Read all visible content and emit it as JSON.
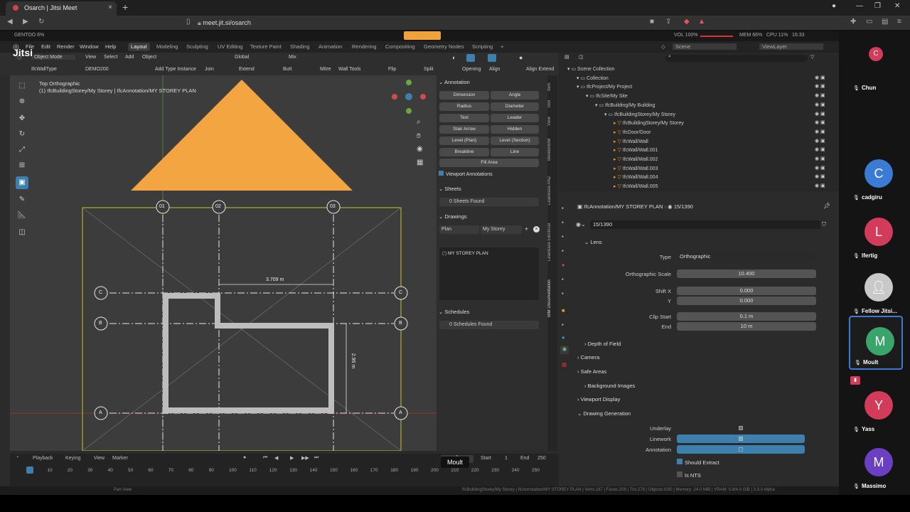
{
  "browser": {
    "tab_title": "Osarch | Jitsi Meet",
    "url": "meet.jit.si/osarch",
    "new_tab_symbol": "+",
    "tab_close": "×"
  },
  "blender_top": {
    "left": "GENTOO 6%",
    "vol": "VOL 100%",
    "mem": "MEM 66%",
    "cpu": "CPU 11%",
    "time": "16:33"
  },
  "menu": {
    "items": [
      "File",
      "Edit",
      "Render",
      "Window",
      "Help"
    ],
    "workspaces": [
      "Layout",
      "Modeling",
      "Sculpting",
      "UV Editing",
      "Texture Paint",
      "Shading",
      "Animation",
      "Rendering",
      "Compositing",
      "Geometry Nodes",
      "Scripting"
    ],
    "active_workspace": "Layout",
    "scene": "Scene",
    "viewlayer": "ViewLayer"
  },
  "header": {
    "mode": "Object Mode",
    "view": "View",
    "select": "Select",
    "add": "Add",
    "object": "Object",
    "transform": "Global",
    "mix": "Mix",
    "wall_type": "IfcWallType",
    "demo": "DEMO200",
    "tools": [
      "Add Type Instance",
      "Join",
      "Extend",
      "Butt",
      "Mitre",
      "Wall Tools",
      "Flip",
      "Split",
      "Opening",
      "Align",
      "Align Extend"
    ]
  },
  "viewport": {
    "title": "Top Orthographic",
    "subtitle": "(1) IfcBuildingStorey/My Storey | IfcAnnotation/MY STOREY PLAN",
    "grid_labels_top": [
      "01",
      "02",
      "03"
    ],
    "grid_labels_side": [
      "C",
      "B",
      "A"
    ],
    "dim_horizontal": "3.709 m",
    "dim_vertical": "2.95 m"
  },
  "npanel": {
    "annotation_title": "Annotation",
    "buttons": [
      [
        "Dimension",
        "Angle"
      ],
      [
        "Radius",
        "Diameter"
      ],
      [
        "Text",
        "Leader"
      ],
      [
        "Stair Arrow",
        "Hidden"
      ],
      [
        "Level (Plan)",
        "Level (Section)"
      ],
      [
        "Breakline",
        "Line"
      ]
    ],
    "fill_area": "Fill Area",
    "viewport_annotations": "Viewport Annotations",
    "sheets_title": "Sheets",
    "sheets_found": "0 Sheets Found",
    "drawings_title": "Drawings",
    "drawing_type": "Plan",
    "drawing_storey": "My Storey",
    "drawing_item": "MY STOREY PLAN",
    "schedules_title": "Schedules",
    "schedules_found": "0 Schedules Found",
    "vtabs": [
      "Item",
      "Tool",
      "View",
      "BlenderBIM",
      "LeanBase ANZ",
      "LeanBase Electrical",
      "BIM Documentation"
    ]
  },
  "timeline": {
    "playback": "Playback",
    "keying": "Keying",
    "view": "View",
    "marker": "Marker",
    "current_frame": "1",
    "start_label": "Start",
    "start_value": "1",
    "end_label": "End",
    "end_value": "250",
    "ticks": [
      "1",
      "10",
      "20",
      "30",
      "40",
      "50",
      "60",
      "70",
      "80",
      "90",
      "100",
      "110",
      "120",
      "130",
      "140",
      "150",
      "160",
      "170",
      "180",
      "190",
      "200",
      "210",
      "220",
      "230",
      "240",
      "250"
    ]
  },
  "status_bar": {
    "left": "Pan View",
    "right": "IfcBuildingStorey/My Storey | IfcAnnotation/MY STOREY PLAN | Verts:187 | Faces:209 | Tris:278 | Objects:0/30 | Memory: 24.0 MiB | VRAM: 0.8/4.0 GiB | 3.3.0 Alpha"
  },
  "outliner": {
    "rows": [
      {
        "label": "Scene Collection",
        "indent": 0
      },
      {
        "label": "Collection",
        "indent": 1
      },
      {
        "label": "IfcProject/My Project",
        "indent": 1
      },
      {
        "label": "IfcSite/My Site",
        "indent": 2
      },
      {
        "label": "IfcBuilding/My Building",
        "indent": 3
      },
      {
        "label": "IfcBuildingStorey/My Storey",
        "indent": 4
      },
      {
        "label": "IfcBuildingStorey/My Storey",
        "indent": 5
      },
      {
        "label": "IfcDoor/Door",
        "indent": 5
      },
      {
        "label": "IfcWall/Wall",
        "indent": 5
      },
      {
        "label": "IfcWall/Wall.001",
        "indent": 5
      },
      {
        "label": "IfcWall/Wall.002",
        "indent": 5
      },
      {
        "label": "IfcWall/Wall.003",
        "indent": 5
      },
      {
        "label": "IfcWall/Wall.004",
        "indent": 5
      },
      {
        "label": "IfcWall/Wall.005",
        "indent": 5
      }
    ]
  },
  "properties": {
    "object_path": "IfcAnnotation/MY STOREY PLAN",
    "data_name_short": "15/1390",
    "data_name": "15/1390",
    "lens_title": "Lens",
    "type_label": "Type",
    "type_value": "Orthographic",
    "ortho_scale_label": "Orthographic Scale",
    "ortho_scale_value": "10.400",
    "shift_x_label": "Shift X",
    "shift_x_value": "0.000",
    "shift_y_label": "Y",
    "shift_y_value": "0.000",
    "clip_start_label": "Clip Start",
    "clip_start_value": "0.1 m",
    "clip_end_label": "End",
    "clip_end_value": "10 m",
    "sections": [
      "Depth of Field",
      "Camera",
      "Safe Areas",
      "Background Images",
      "Viewport Display",
      "Drawing Generation"
    ],
    "underlay_label": "Underlay",
    "linework_label": "Linework",
    "annotation_label": "Annotation",
    "should_extract": "Should Extract",
    "is_nts": "Is NTS"
  },
  "jitsi": {
    "app_name": "Jitsi",
    "participants": [
      {
        "initial": "C",
        "name": "Chun",
        "color": "#d23b5a"
      },
      {
        "initial": "C",
        "name": "cadgiru",
        "color": "#3a7bd5"
      },
      {
        "initial": "L",
        "name": "lfertig",
        "color": "#d23b5a"
      },
      {
        "initial": "",
        "name": "Fellow Jitsi...",
        "color": "#c9c9c9"
      },
      {
        "initial": "M",
        "name": "Moult",
        "color": "#3aa56b"
      },
      {
        "initial": "Y",
        "name": "Yass",
        "color": "#d23b5a"
      },
      {
        "initial": "M",
        "name": "Massimo",
        "color": "#6a3fc1"
      }
    ],
    "speaker_tooltip": "Moult"
  },
  "colors": {
    "accent_blue": "#3d7fad",
    "triangle_orange": "#f3a541",
    "wall_grey": "#bdbdbd"
  }
}
